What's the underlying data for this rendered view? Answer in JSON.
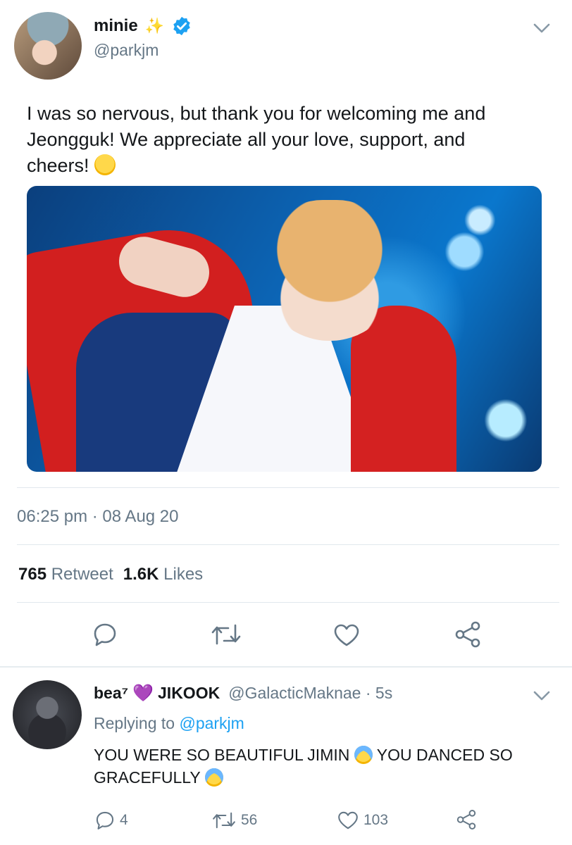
{
  "tweet": {
    "display_name": "minie",
    "name_emoji": "✨",
    "handle": "@parkjm",
    "text_line1": "I was so nervous, but thank you for welcoming me and",
    "text_line2": "Jeongguk! We appreciate all your love, support, and",
    "text_line3": "cheers!",
    "timestamp": "06:25 pm · 08 Aug 20",
    "retweet_count": "765",
    "retweet_label": "Retweet",
    "likes_count": "1.6K",
    "likes_label": "Likes"
  },
  "reply": {
    "display_name_prefix": "bea⁷",
    "display_name_heart": "💜",
    "display_name_suffix": "JIKOOK",
    "handle_time": "@GalacticMaknae · 5s",
    "replying_prefix": "Replying to",
    "replying_handle": "@parkjm",
    "text_part1": "YOU WERE SO BEAUTIFUL JIMIN",
    "text_part2": "YOU DANCED SO",
    "text_part3": "GRACEFULLY",
    "reply_count": "4",
    "retweet_count": "56",
    "like_count": "103"
  },
  "icons": {
    "verified": "verified-badge-icon",
    "chevron": "chevron-down-icon",
    "reply": "reply-icon",
    "retweet": "retweet-icon",
    "like": "heart-icon",
    "share": "share-icon"
  },
  "colors": {
    "accent": "#1da1f2",
    "muted": "#657786",
    "heart_purple": "#7a1fd6"
  }
}
